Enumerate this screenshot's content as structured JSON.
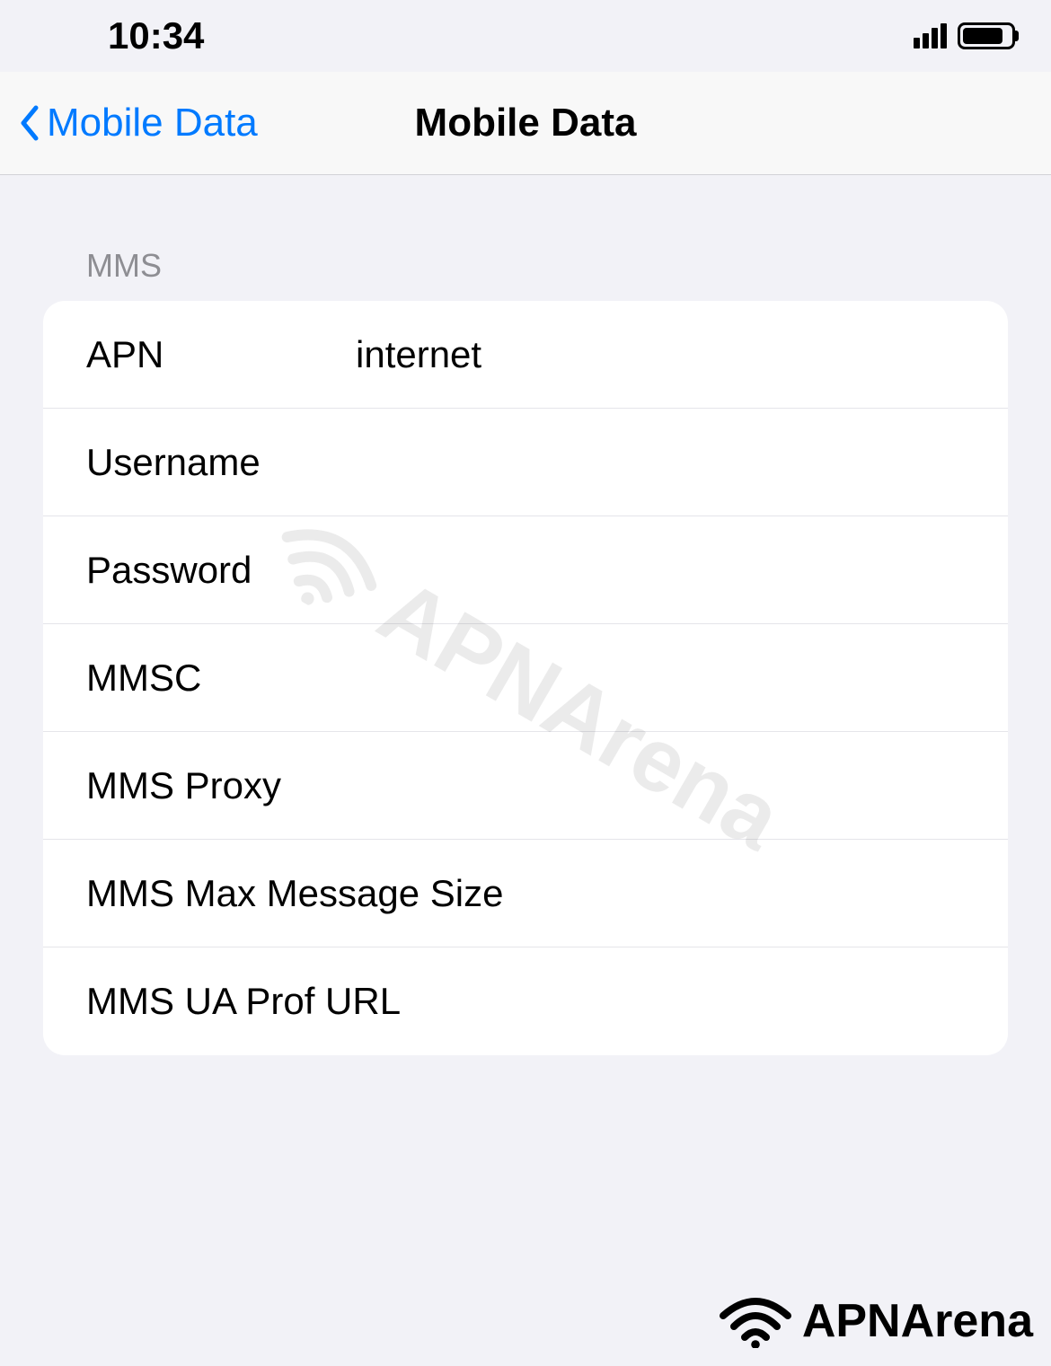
{
  "status_bar": {
    "time": "10:34"
  },
  "nav": {
    "back_label": "Mobile Data",
    "title": "Mobile Data"
  },
  "section": {
    "header": "MMS",
    "rows": {
      "apn": {
        "label": "APN",
        "value": "internet"
      },
      "username": {
        "label": "Username",
        "value": ""
      },
      "password": {
        "label": "Password",
        "value": ""
      },
      "mmsc": {
        "label": "MMSC",
        "value": ""
      },
      "mms_proxy": {
        "label": "MMS Proxy",
        "value": ""
      },
      "mms_max_size": {
        "label": "MMS Max Message Size",
        "value": ""
      },
      "mms_ua_prof": {
        "label": "MMS UA Prof URL",
        "value": ""
      }
    }
  },
  "watermark": "APNArena",
  "footer_logo": "APNArena"
}
